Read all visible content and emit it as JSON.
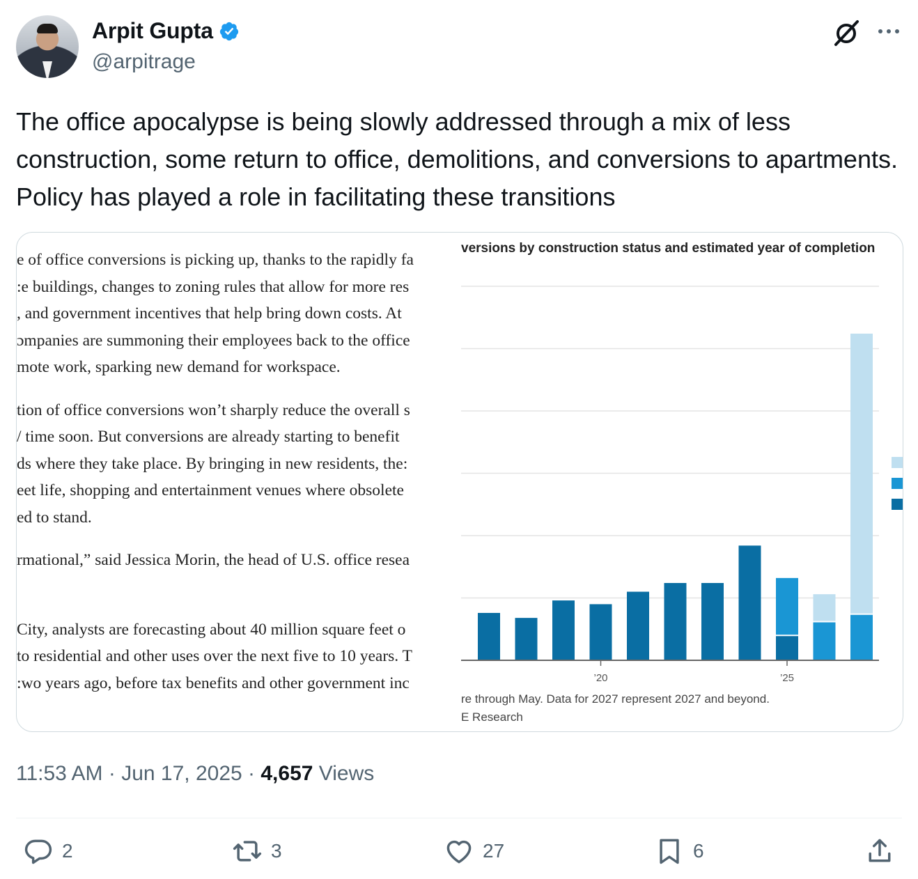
{
  "author": {
    "name": "Arpit Gupta",
    "handle": "@arpitrage",
    "verified": true,
    "verified_color": "#1d9bf0"
  },
  "header_icons": [
    "grok-icon",
    "more-icon"
  ],
  "tweet": {
    "text": "The office apocalypse is being slowly addressed through a mix of less construction, some return to office, demolitions, and conversions to apartments. Policy has played a role in facilitating these transitions"
  },
  "media": {
    "article_paragraphs": [
      [
        "e of office conversions is picking up, thanks to the rapidly fa",
        ":e buildings, changes to zoning rules that allow for more res",
        ", and government incentives that help bring down costs. At",
        "ɔmpanies are summoning their employees back to the office",
        "mote work, sparking new demand for workspace."
      ],
      [
        "tion of office conversions won’t sharply reduce the overall s",
        "/ time soon. But conversions are already starting to benefit",
        "ds where they take place. By bringing in new residents, the:",
        "eet life, shopping and entertainment venues where obsolete",
        "ed to stand."
      ],
      [
        "rmational,” said Jessica Morin, the head of U.S. office resea"
      ],
      [
        "City, analysts are forecasting about 40 million square feet o",
        "to residential and other uses over the next five to 10 years. T",
        ":wo years ago, before tax benefits and other government inc"
      ]
    ],
    "chart_title": "versions by construction status and estimated year of completion",
    "chart_note": "re through May. Data for 2027 represent 2027 and beyond.",
    "chart_source": "E Research"
  },
  "chart_data": {
    "type": "bar",
    "stacked": true,
    "categories": [
      "2017",
      "2018",
      "2019",
      "2020",
      "2021",
      "2022",
      "2023",
      "2024",
      "2025",
      "2026",
      "2027"
    ],
    "tick_labels": [
      {
        "at": "2020",
        "label": "’20"
      },
      {
        "at": "2025",
        "label": "’25"
      }
    ],
    "series": [
      {
        "color": "#0a6ea3",
        "values": [
          38,
          34,
          48,
          45,
          55,
          62,
          62,
          92,
          20,
          0,
          0
        ]
      },
      {
        "color": "#1a96d4",
        "values": [
          0,
          0,
          0,
          0,
          0,
          0,
          0,
          0,
          46,
          31,
          37
        ]
      },
      {
        "color": "#bfdff0",
        "values": [
          0,
          0,
          0,
          0,
          0,
          0,
          0,
          0,
          0,
          22,
          225
        ]
      }
    ],
    "ylim": [
      0,
      300
    ],
    "grid": true,
    "legend_swatches": [
      "#bfdff0",
      "#1a96d4",
      "#0a6ea3"
    ]
  },
  "timestamp": {
    "time": "11:53 AM",
    "date": "Jun 17, 2025",
    "views_count": "4,657",
    "views_label": "Views"
  },
  "actions": {
    "replies": "2",
    "reposts": "3",
    "likes": "27",
    "bookmarks": "6"
  }
}
